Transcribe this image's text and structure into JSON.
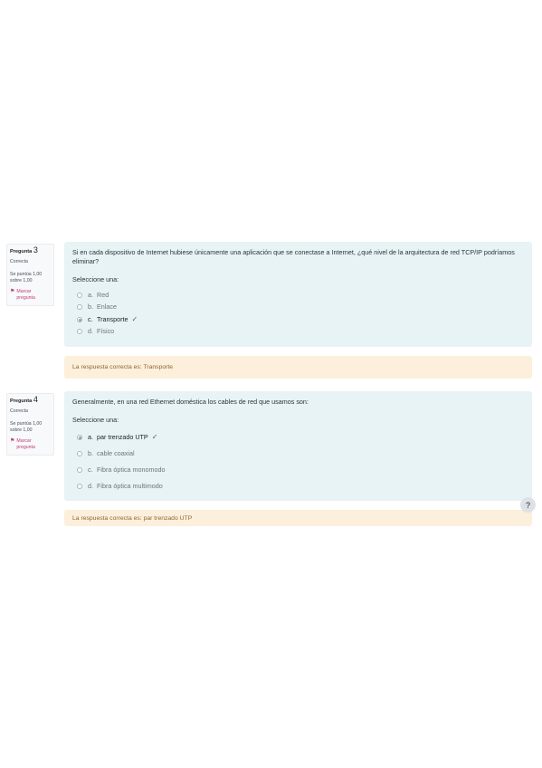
{
  "questions": [
    {
      "label": "Pregunta",
      "number": "3",
      "state": "Correcta",
      "grade": "Se puntúa 1,00 sobre 1,00",
      "flag_label": "Marcar pregunta",
      "text": "Si en cada dispositivo de Internet hubiese únicamente una aplicación que se conectase a Internet, ¿qué nivel de la arquitectura de red TCP/IP podríamos eliminar?",
      "prompt": "Seleccione una:",
      "options": [
        {
          "letter": "a.",
          "text": "Red",
          "selected": false,
          "correct": false
        },
        {
          "letter": "b.",
          "text": "Enlace",
          "selected": false,
          "correct": false
        },
        {
          "letter": "c.",
          "text": "Transporte",
          "selected": true,
          "correct": true
        },
        {
          "letter": "d.",
          "text": "Físico",
          "selected": false,
          "correct": false
        }
      ],
      "feedback": "La respuesta correcta es: Transporte"
    },
    {
      "label": "Pregunta",
      "number": "4",
      "state": "Correcta",
      "grade": "Se puntúa 1,00 sobre 1,00",
      "flag_label": "Marcar pregunta",
      "text": "Generalmente, en una red Ethernet doméstica los cables de red que usamos son:",
      "prompt": "Seleccione una:",
      "options": [
        {
          "letter": "a.",
          "text": "par trenzado UTP",
          "selected": true,
          "correct": true
        },
        {
          "letter": "b.",
          "text": "cable coaxial",
          "selected": false,
          "correct": false
        },
        {
          "letter": "c.",
          "text": "Fibra óptica monomodo",
          "selected": false,
          "correct": false
        },
        {
          "letter": "d.",
          "text": "Fibra óptica multimodo",
          "selected": false,
          "correct": false
        }
      ],
      "feedback": "La respuesta correcta es: par trenzado UTP"
    }
  ],
  "help_label": "?",
  "colors": {
    "formulation_bg": "#e7f3f5",
    "feedback_bg": "#fcefdc",
    "correct": "#357a32",
    "flag": "#c23a74"
  }
}
